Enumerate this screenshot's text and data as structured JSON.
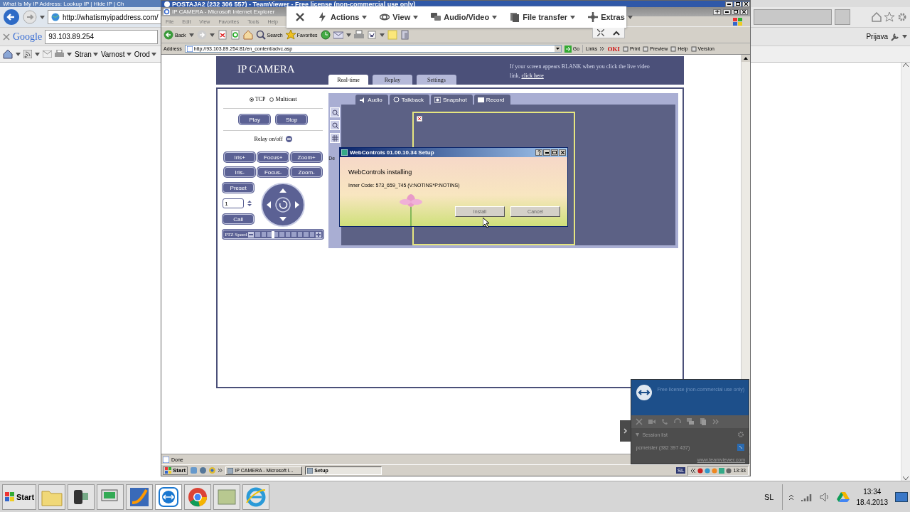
{
  "host_browser": {
    "title": "What Is My IP Address: Lookup IP | Hide IP | Ch",
    "address": "http://whatismyipaddress.com/",
    "search_engine": "Google",
    "search_value": "93.103.89.254",
    "commands": [
      "Stran",
      "Varnost",
      "Orod"
    ],
    "sign_in": "Prijava"
  },
  "teamviewer": {
    "title": "POSTAJA2 (232 306 557) - TeamViewer - Free license (non-commercial use only)",
    "toolbar": [
      "Actions",
      "View",
      "Audio/Video",
      "File transfer",
      "Extras"
    ]
  },
  "remote_browser": {
    "title": "IP CAMERA - Microsoft Internet Explorer",
    "menu": [
      "File",
      "Edit",
      "View",
      "Favorites",
      "Tools",
      "Help"
    ],
    "toolbar": [
      "Back",
      "Search",
      "Favorites"
    ],
    "address_label": "Address",
    "address": "http://93.103.89.254:81/en_content/advc.asp",
    "go": "Go",
    "links": "Links",
    "links_toolbar": [
      "OKI",
      "Print",
      "Preview",
      "Help",
      "Version"
    ],
    "status": "Done"
  },
  "camera_page": {
    "title": "IP CAMERA",
    "tabs": [
      {
        "label": "Real-time",
        "selected": true
      },
      {
        "label": "Replay",
        "selected": false
      },
      {
        "label": "Settings",
        "selected": false
      }
    ],
    "notice": "If your screen appears BLANK when you click the live video link,",
    "notice_link": "click here",
    "protocols": [
      {
        "label": "TCP",
        "selected": true
      },
      {
        "label": "Multicast",
        "selected": false
      }
    ],
    "stream_buttons": [
      "Play",
      "Stop"
    ],
    "relay_label": "Relay on/off",
    "lens_buttons": [
      "Iris+",
      "Focus+",
      "Zoom+",
      "Iris-",
      "Focus-",
      "Zoom-"
    ],
    "preset_button": "Preset",
    "preset_value": "1",
    "call_button": "Call",
    "ptz_speed": {
      "label": "PTZ Speed",
      "level": 0.3
    },
    "video_tabs": [
      "Audio",
      "Talkback",
      "Snapshot",
      "Record"
    ],
    "side_label": "De"
  },
  "setup_dialog": {
    "title": "WebControls 01.00.10.34 Setup",
    "heading": "WebControls installing",
    "inner_code": "Inner Code: 573_659_745 (V:NOTINS*P:NOTINS)",
    "buttons": [
      {
        "label": "Install",
        "disabled": true
      },
      {
        "label": "Cancel",
        "disabled": true
      }
    ]
  },
  "remote_taskbar": {
    "start": "Start",
    "tasks": [
      {
        "label": "IP CAMERA - Microsoft I...",
        "selected": false
      },
      {
        "label": "Setup",
        "selected": true
      }
    ],
    "tray_badge": "SL",
    "clock": "13:33"
  },
  "teamviewer_panel": {
    "license": "Free license (non-commercial use only)",
    "session_list": "Session list",
    "partner": "pcmeister (382 397 437)",
    "website": "www.teamviewer.com"
  },
  "taskbar": {
    "start": "Start",
    "language": "SL",
    "time": "13:34",
    "date": "18.4.2013"
  }
}
